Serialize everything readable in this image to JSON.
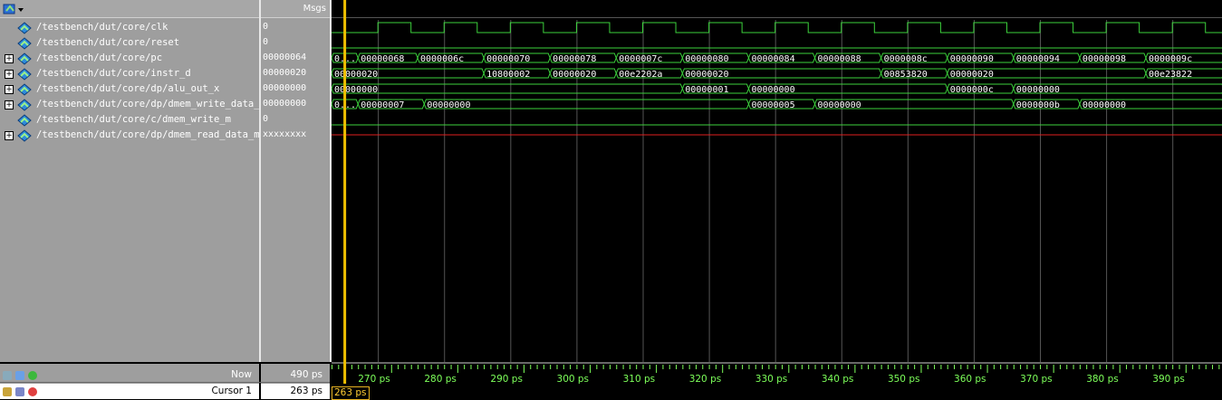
{
  "header": {
    "msgs_label": "Msgs"
  },
  "signals": [
    {
      "name": "/testbench/dut/core/clk",
      "value": "0",
      "expandable": false
    },
    {
      "name": "/testbench/dut/core/reset",
      "value": "0",
      "expandable": false
    },
    {
      "name": "/testbench/dut/core/pc",
      "value": "00000064",
      "expandable": true
    },
    {
      "name": "/testbench/dut/core/instr_d",
      "value": "00000020",
      "expandable": true
    },
    {
      "name": "/testbench/dut/core/dp/alu_out_x",
      "value": "00000000",
      "expandable": true
    },
    {
      "name": "/testbench/dut/core/dp/dmem_write_data_m",
      "value": "00000000",
      "expandable": true
    },
    {
      "name": "/testbench/dut/core/c/dmem_write_m",
      "value": "0",
      "expandable": false
    },
    {
      "name": "/testbench/dut/core/dp/dmem_read_data_m",
      "value": "xxxxxxxx",
      "expandable": true
    }
  ],
  "waves": {
    "time_start_ps": 261,
    "time_end_ps": 395.5,
    "clk_period_ps": 10,
    "clk_first_rise_ps": 268,
    "reset_value": "0",
    "dmem_write_m_value": "0",
    "read_data_value": "xxxxxxxx",
    "buses": [
      {
        "signal": "pc",
        "segments": [
          {
            "start": 261,
            "label": "0..."
          },
          {
            "start": 265,
            "label": "00000068"
          },
          {
            "start": 274,
            "label": "0000006c"
          },
          {
            "start": 284,
            "label": "00000070"
          },
          {
            "start": 294,
            "label": "00000078"
          },
          {
            "start": 304,
            "label": "0000007c"
          },
          {
            "start": 314,
            "label": "00000080"
          },
          {
            "start": 324,
            "label": "00000084"
          },
          {
            "start": 334,
            "label": "00000088"
          },
          {
            "start": 344,
            "label": "0000008c"
          },
          {
            "start": 354,
            "label": "00000090"
          },
          {
            "start": 364,
            "label": "00000094"
          },
          {
            "start": 374,
            "label": "00000098"
          },
          {
            "start": 384,
            "label": "0000009c"
          }
        ]
      },
      {
        "signal": "instr_d",
        "segments": [
          {
            "start": 261,
            "label": "00000020"
          },
          {
            "start": 284,
            "label": "10800002"
          },
          {
            "start": 294,
            "label": "00000020"
          },
          {
            "start": 304,
            "label": "00e2202a"
          },
          {
            "start": 314,
            "label": "00000020"
          },
          {
            "start": 344,
            "label": "00853820"
          },
          {
            "start": 354,
            "label": "00000020"
          },
          {
            "start": 384,
            "label": "00e23822"
          }
        ]
      },
      {
        "signal": "alu_out_x",
        "segments": [
          {
            "start": 261,
            "label": "00000000"
          },
          {
            "start": 314,
            "label": "00000001"
          },
          {
            "start": 324,
            "label": "00000000"
          },
          {
            "start": 354,
            "label": "0000000c"
          },
          {
            "start": 364,
            "label": "00000000"
          }
        ]
      },
      {
        "signal": "dmem_write_data_m",
        "segments": [
          {
            "start": 261,
            "label": "0..."
          },
          {
            "start": 265,
            "label": "00000007"
          },
          {
            "start": 275,
            "label": "00000000"
          },
          {
            "start": 324,
            "label": "00000005"
          },
          {
            "start": 334,
            "label": "00000000"
          },
          {
            "start": 364,
            "label": "0000000b"
          },
          {
            "start": 374,
            "label": "00000000"
          }
        ]
      }
    ]
  },
  "timeline": {
    "ticks": [
      {
        "t": 270,
        "label": "270 ps"
      },
      {
        "t": 280,
        "label": "280 ps"
      },
      {
        "t": 290,
        "label": "290 ps"
      },
      {
        "t": 300,
        "label": "300 ps"
      },
      {
        "t": 310,
        "label": "310 ps"
      },
      {
        "t": 320,
        "label": "320 ps"
      },
      {
        "t": 330,
        "label": "330 ps"
      },
      {
        "t": 340,
        "label": "340 ps"
      },
      {
        "t": 350,
        "label": "350 ps"
      },
      {
        "t": 360,
        "label": "360 ps"
      },
      {
        "t": 370,
        "label": "370 ps"
      },
      {
        "t": 380,
        "label": "380 ps"
      },
      {
        "t": 390,
        "label": "390 ps"
      }
    ]
  },
  "status": {
    "now_label": "Now",
    "now_value": "490 ps",
    "cursor_label": "Cursor 1",
    "cursor_value": "263 ps",
    "cursor_time_ps": 263,
    "cursor_tag": "263 ps"
  },
  "colors": {
    "wave_green": "#3cd23c",
    "cursor_yellow": "#f0c000",
    "undefined_red": "#e02020",
    "tick_text": "#7dff5a",
    "pane_gray": "#9e9e9e"
  }
}
